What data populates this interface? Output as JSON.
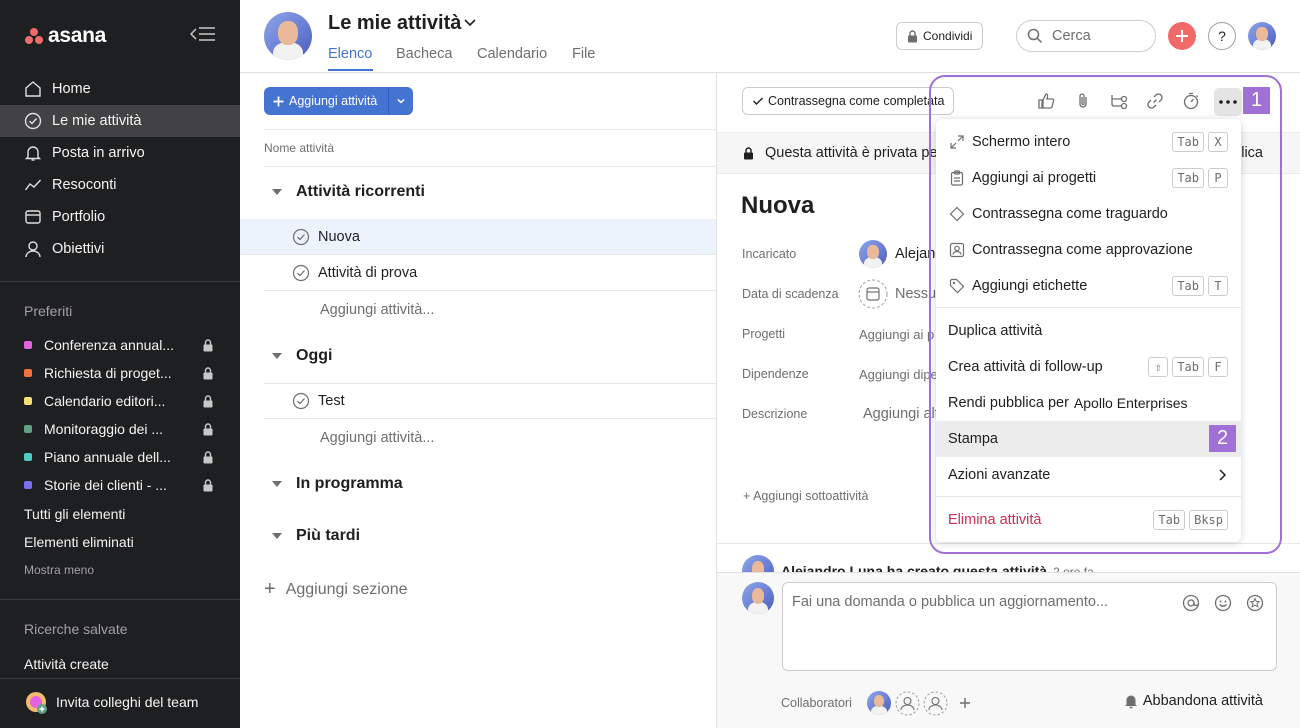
{
  "app": {
    "logo": "asana"
  },
  "sidebar": {
    "nav": [
      {
        "label": "Home",
        "icon": "home-icon"
      },
      {
        "label": "Le mie attività",
        "icon": "check-circle-icon",
        "active": true
      },
      {
        "label": "Posta in arrivo",
        "icon": "bell-icon"
      },
      {
        "label": "Resoconti",
        "icon": "line-chart-icon"
      },
      {
        "label": "Portfolio",
        "icon": "portfolio-icon"
      },
      {
        "label": "Obiettivi",
        "icon": "person-icon"
      }
    ],
    "favorites_title": "Preferiti",
    "favorites": [
      {
        "label": "Conferenza annual...",
        "color": "#e362e3"
      },
      {
        "label": "Richiesta di proget...",
        "color": "#f27340"
      },
      {
        "label": "Calendario editori...",
        "color": "#f8df72"
      },
      {
        "label": "Monitoraggio dei ...",
        "color": "#5da283"
      },
      {
        "label": "Piano annuale dell...",
        "color": "#4ecbc4"
      },
      {
        "label": "Storie dei clienti - ...",
        "color": "#7a6ff0"
      }
    ],
    "all_items": "Tutti gli elementi",
    "deleted_items": "Elementi eliminati",
    "show_less": "Mostra meno",
    "saved_title": "Ricerche salvate",
    "saved_item": "Attività create",
    "invite": "Invita colleghi del team"
  },
  "header": {
    "title": "Le mie attività",
    "tabs": [
      "Elenco",
      "Bacheca",
      "Calendario",
      "File"
    ],
    "share": "Condividi",
    "search_placeholder": "Cerca",
    "help": "?"
  },
  "list": {
    "add_task": "Aggiungi attività",
    "column_header": "Nome attività",
    "sections": [
      {
        "title": "Attività ricorrenti",
        "tasks": [
          "Nuova",
          "Attività di prova"
        ],
        "add": "Aggiungi attività..."
      },
      {
        "title": "Oggi",
        "tasks": [
          "Test"
        ],
        "add": "Aggiungi attività..."
      },
      {
        "title": "In programma",
        "tasks": []
      },
      {
        "title": "Più tardi",
        "tasks": []
      }
    ],
    "add_section": "Aggiungi sezione"
  },
  "detail": {
    "complete_button": "Contrassegna come completata",
    "private_notice": "Questa attività è privata pe",
    "private_end": "lica",
    "title": "Nuova",
    "fields": [
      {
        "label": "Incaricato",
        "value": "Alejand"
      },
      {
        "label": "Data di scadenza",
        "value": "Nessu"
      },
      {
        "label": "Progetti",
        "value": "Aggiungi ai p"
      },
      {
        "label": "Dipendenze",
        "value": "Aggiungi dipe"
      },
      {
        "label": "Descrizione",
        "value": "Aggiungi alt"
      }
    ],
    "add_subtask": "Aggiungi sottoattività",
    "activity": "Alejandro Luna ha creato questa attività",
    "activity_time": "2 ore fa",
    "comment_placeholder": "Fai una domanda o pubblica un aggiornamento...",
    "collaborators_label": "Collaboratori",
    "leave": "Abbandona attività"
  },
  "menu": {
    "items": [
      {
        "label": "Schermo intero",
        "icon": "expand-icon",
        "keys": [
          "Tab",
          "X"
        ]
      },
      {
        "label": "Aggiungi ai progetti",
        "icon": "clipboard-icon",
        "keys": [
          "Tab",
          "P"
        ]
      },
      {
        "label": "Contrassegna come traguardo",
        "icon": "diamond-icon",
        "keys": []
      },
      {
        "label": "Contrassegna come approvazione",
        "icon": "approval-icon",
        "keys": []
      },
      {
        "label": "Aggiungi etichette",
        "icon": "tag-icon",
        "keys": [
          "Tab",
          "T"
        ]
      },
      {
        "label": "Duplica attività",
        "keys": []
      },
      {
        "label": "Crea attività di follow-up",
        "keys": [
          "⇧",
          "Tab",
          "F"
        ]
      },
      {
        "label": "Rendi pubblica per",
        "org": "Apollo Enterprises",
        "keys": []
      },
      {
        "label": "Stampa",
        "keys": [],
        "hover": true
      },
      {
        "label": "Azioni avanzate",
        "keys": []
      },
      {
        "label": "Elimina attività",
        "keys": [
          "Tab",
          "Bksp"
        ],
        "danger": true
      }
    ]
  },
  "annotations": [
    "1",
    "2"
  ]
}
